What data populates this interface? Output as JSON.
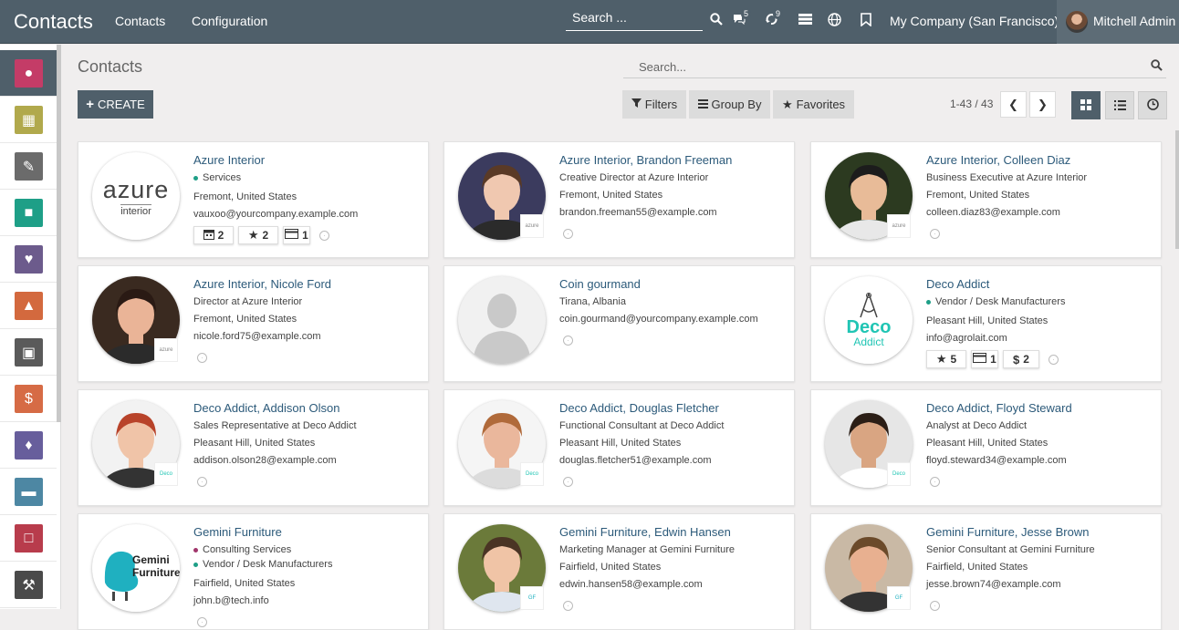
{
  "topbar": {
    "app_title": "Contacts",
    "nav": [
      "Contacts",
      "Configuration"
    ],
    "search_placeholder": "Search ...",
    "chat_count": "5",
    "activity_count": "9",
    "company": "My Company (San Francisco)",
    "user": "Mitchell Admin"
  },
  "sidebar": {
    "items": [
      {
        "icon": "discuss-icon",
        "color": "#c43c67"
      },
      {
        "icon": "calendar-icon",
        "color": "#b1a94c"
      },
      {
        "icon": "notes-icon",
        "color": "#6b6b6b"
      },
      {
        "icon": "contacts-icon",
        "color": "#1e9f87"
      },
      {
        "icon": "crm-icon",
        "color": "#6c5b8c"
      },
      {
        "icon": "sales-icon",
        "color": "#d3693e"
      },
      {
        "icon": "point-of-sale-icon",
        "color": "#5a5a5a"
      },
      {
        "icon": "invoicing-icon",
        "color": "#d66b45"
      },
      {
        "icon": "apps-icon",
        "color": "#675e9c"
      },
      {
        "icon": "website-icon",
        "color": "#4d87a3"
      },
      {
        "icon": "inventory-icon",
        "color": "#b83c4c"
      },
      {
        "icon": "settings-icon",
        "color": "#4a4a4a"
      }
    ]
  },
  "controlpanel": {
    "title": "Contacts",
    "search_placeholder": "Search...",
    "create_label": "CREATE",
    "filters_label": "Filters",
    "groupby_label": "Group By",
    "favorites_label": "Favorites",
    "pager": "1-43 / 43"
  },
  "cards": [
    {
      "name": "Azure Interior",
      "tags": [
        {
          "label": "Services",
          "color": "#1e9f87"
        }
      ],
      "lines": [
        "Fremont, United States",
        "vauxoo@yourcompany.example.com"
      ],
      "chips": [
        {
          "icon": "calendar",
          "n": "2"
        },
        {
          "icon": "star",
          "n": "2"
        },
        {
          "icon": "card",
          "n": "1"
        }
      ]
    },
    {
      "name": "Azure Interior, Brandon Freeman",
      "tags": [],
      "lines": [
        "Creative Director at Azure Interior",
        "Fremont, United States",
        "brandon.freeman55@example.com"
      ],
      "chips": []
    },
    {
      "name": "Azure Interior, Colleen Diaz",
      "tags": [],
      "lines": [
        "Business Executive at Azure Interior",
        "Fremont, United States",
        "colleen.diaz83@example.com"
      ],
      "chips": []
    },
    {
      "name": "Azure Interior, Nicole Ford",
      "tags": [],
      "lines": [
        "Director at Azure Interior",
        "Fremont, United States",
        "nicole.ford75@example.com"
      ],
      "chips": []
    },
    {
      "name": "Coin gourmand",
      "tags": [],
      "lines": [
        "Tirana, Albania",
        "coin.gourmand@yourcompany.example.com"
      ],
      "chips": []
    },
    {
      "name": "Deco Addict",
      "tags": [
        {
          "label": "Vendor / Desk Manufacturers",
          "color": "#1e9f87"
        }
      ],
      "lines": [
        "Pleasant Hill, United States",
        "info@agrolait.com"
      ],
      "chips": [
        {
          "icon": "star",
          "n": "5"
        },
        {
          "icon": "card",
          "n": "1"
        },
        {
          "icon": "dollar",
          "n": "2"
        }
      ]
    },
    {
      "name": "Deco Addict, Addison Olson",
      "tags": [],
      "lines": [
        "Sales Representative at Deco Addict",
        "Pleasant Hill, United States",
        "addison.olson28@example.com"
      ],
      "chips": []
    },
    {
      "name": "Deco Addict, Douglas Fletcher",
      "tags": [],
      "lines": [
        "Functional Consultant at Deco Addict",
        "Pleasant Hill, United States",
        "douglas.fletcher51@example.com"
      ],
      "chips": []
    },
    {
      "name": "Deco Addict, Floyd Steward",
      "tags": [],
      "lines": [
        "Analyst at Deco Addict",
        "Pleasant Hill, United States",
        "floyd.steward34@example.com"
      ],
      "chips": []
    },
    {
      "name": "Gemini Furniture",
      "tags": [
        {
          "label": "Consulting Services",
          "color": "#a0356b"
        },
        {
          "label": "Vendor / Desk Manufacturers",
          "color": "#1e9f87"
        }
      ],
      "lines": [
        "Fairfield, United States",
        "john.b@tech.info"
      ],
      "chips": []
    },
    {
      "name": "Gemini Furniture, Edwin Hansen",
      "tags": [],
      "lines": [
        "Marketing Manager at Gemini Furniture",
        "Fairfield, United States",
        "edwin.hansen58@example.com"
      ],
      "chips": []
    },
    {
      "name": "Gemini Furniture, Jesse Brown",
      "tags": [],
      "lines": [
        "Senior Consultant at Gemini Furniture",
        "Fairfield, United States",
        "jesse.brown74@example.com"
      ],
      "chips": []
    }
  ],
  "logos": {
    "azure": "azure",
    "azure_sub": "interior",
    "deco": "Deco",
    "deco_sub": "Addict",
    "gemini": "Gemini",
    "gemini_sub": "Furniture"
  }
}
